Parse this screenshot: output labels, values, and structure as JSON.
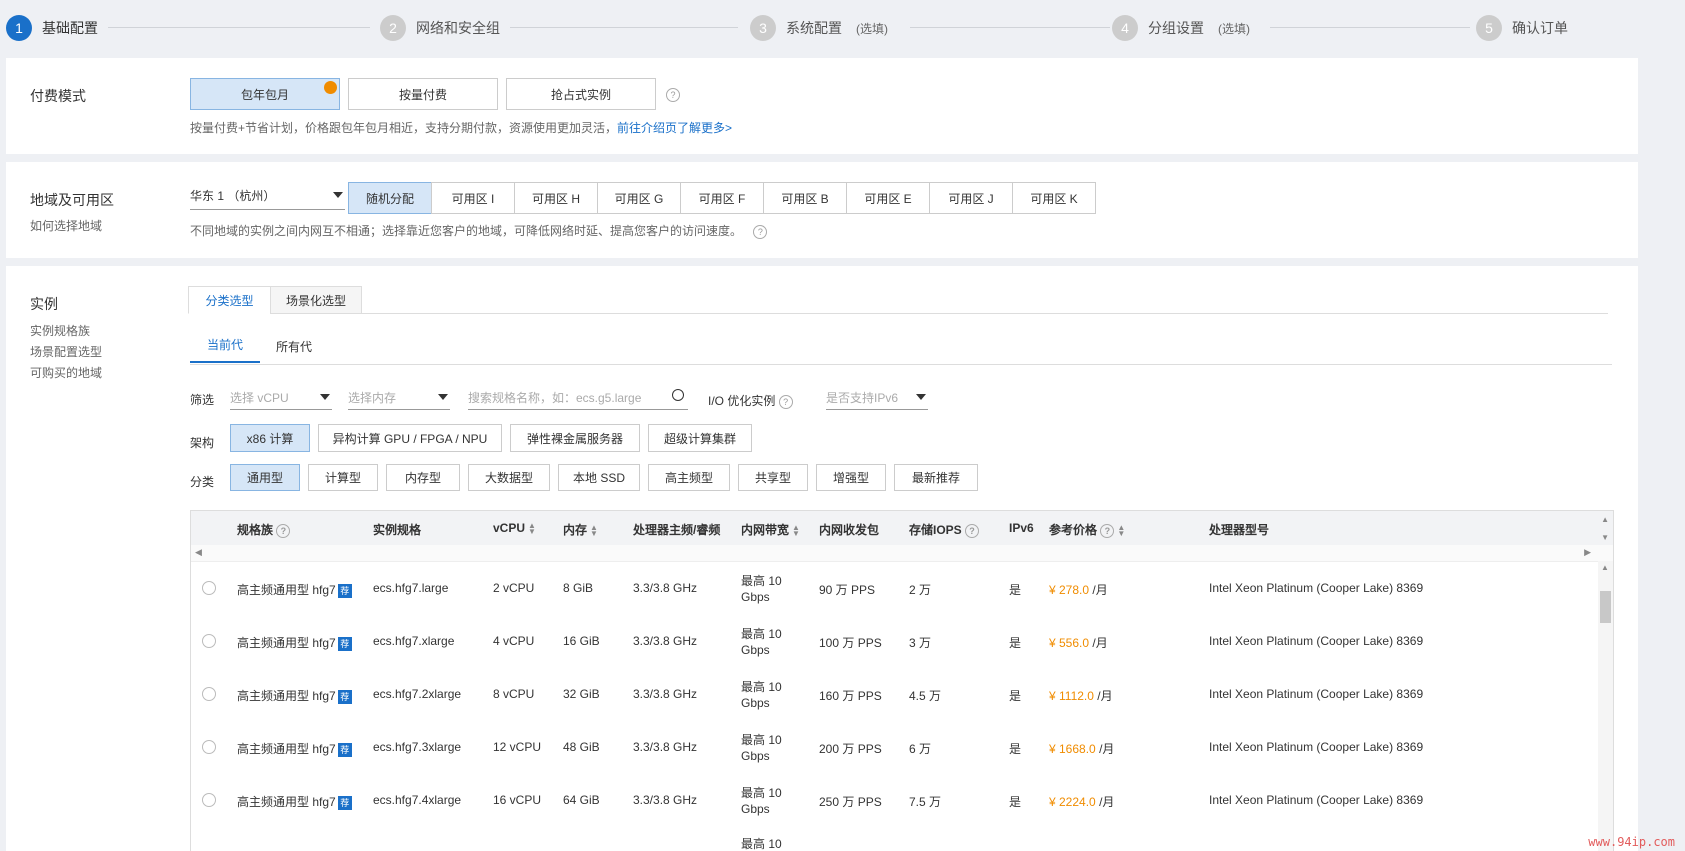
{
  "steps": [
    {
      "num": "1",
      "label": "基础配置",
      "optional": ""
    },
    {
      "num": "2",
      "label": "网络和安全组",
      "optional": ""
    },
    {
      "num": "3",
      "label": "系统配置",
      "optional": "(选填)"
    },
    {
      "num": "4",
      "label": "分组设置",
      "optional": "(选填)"
    },
    {
      "num": "5",
      "label": "确认订单",
      "optional": ""
    }
  ],
  "billing": {
    "title": "付费模式",
    "options": [
      "包年包月",
      "按量付费",
      "抢占式实例"
    ],
    "selected": "包年包月",
    "hint": "按量付费+节省计划，价格跟包年包月相近，支持分期付款，资源使用更加灵活，",
    "hint_link": "前往介绍页了解更多>"
  },
  "region": {
    "title": "地域及可用区",
    "subtitle": "如何选择地域",
    "selected_region": "华东 1 （杭州）",
    "zones": [
      "随机分配",
      "可用区 I",
      "可用区 H",
      "可用区 G",
      "可用区 F",
      "可用区 B",
      "可用区 E",
      "可用区 J",
      "可用区 K"
    ],
    "selected_zone": "随机分配",
    "hint": "不同地域的实例之间内网互不相通；选择靠近您客户的地域，可降低网络时延、提高您客户的访问速度。"
  },
  "instance": {
    "title": "实例",
    "side_links": [
      "实例规格族",
      "场景配置选型",
      "可购买的地域"
    ],
    "tabs": [
      "分类选型",
      "场景化选型"
    ],
    "subtabs": [
      "当前代",
      "所有代"
    ],
    "filter": {
      "label": "筛选",
      "vcpu_placeholder": "选择 vCPU",
      "mem_placeholder": "选择内存",
      "search_placeholder": "搜索规格名称，如：ecs.g5.large",
      "io_label": "I/O 优化实例",
      "ipv6_placeholder": "是否支持IPv6"
    },
    "arch": {
      "label": "架构",
      "options": [
        "x86 计算",
        "异构计算 GPU / FPGA / NPU",
        "弹性裸金属服务器",
        "超级计算集群"
      ],
      "selected": "x86 计算"
    },
    "category": {
      "label": "分类",
      "options": [
        "通用型",
        "计算型",
        "内存型",
        "大数据型",
        "本地 SSD",
        "高主频型",
        "共享型",
        "增强型",
        "最新推荐"
      ],
      "selected": "通用型"
    },
    "table": {
      "headers": [
        "规格族",
        "实例规格",
        "vCPU",
        "内存",
        "处理器主频/睿频",
        "内网带宽",
        "内网收发包",
        "存储IOPS",
        "IPv6",
        "参考价格",
        "处理器型号"
      ],
      "rec_badge": "荐",
      "rows": [
        {
          "family": "高主频通用型 hfg7",
          "spec": "ecs.hfg7.large",
          "vcpu": "2 vCPU",
          "mem": "8 GiB",
          "freq": "3.3/3.8 GHz",
          "bw1": "最高 10",
          "bw2": "Gbps",
          "pps": "90 万 PPS",
          "iops": "2 万",
          "ipv6": "是",
          "price": "¥ 278.0",
          "unit": "/月",
          "cpu": "Intel Xeon Platinum (Cooper Lake) 8369"
        },
        {
          "family": "高主频通用型 hfg7",
          "spec": "ecs.hfg7.xlarge",
          "vcpu": "4 vCPU",
          "mem": "16 GiB",
          "freq": "3.3/3.8 GHz",
          "bw1": "最高 10",
          "bw2": "Gbps",
          "pps": "100 万 PPS",
          "iops": "3 万",
          "ipv6": "是",
          "price": "¥ 556.0",
          "unit": "/月",
          "cpu": "Intel Xeon Platinum (Cooper Lake) 8369"
        },
        {
          "family": "高主频通用型 hfg7",
          "spec": "ecs.hfg7.2xlarge",
          "vcpu": "8 vCPU",
          "mem": "32 GiB",
          "freq": "3.3/3.8 GHz",
          "bw1": "最高 10",
          "bw2": "Gbps",
          "pps": "160 万 PPS",
          "iops": "4.5 万",
          "ipv6": "是",
          "price": "¥ 1112.0",
          "unit": "/月",
          "cpu": "Intel Xeon Platinum (Cooper Lake) 8369"
        },
        {
          "family": "高主频通用型 hfg7",
          "spec": "ecs.hfg7.3xlarge",
          "vcpu": "12 vCPU",
          "mem": "48 GiB",
          "freq": "3.3/3.8 GHz",
          "bw1": "最高 10",
          "bw2": "Gbps",
          "pps": "200 万 PPS",
          "iops": "6 万",
          "ipv6": "是",
          "price": "¥ 1668.0",
          "unit": "/月",
          "cpu": "Intel Xeon Platinum (Cooper Lake) 8369"
        },
        {
          "family": "高主频通用型 hfg7",
          "spec": "ecs.hfg7.4xlarge",
          "vcpu": "16 vCPU",
          "mem": "64 GiB",
          "freq": "3.3/3.8 GHz",
          "bw1": "最高 10",
          "bw2": "Gbps",
          "pps": "250 万 PPS",
          "iops": "7.5 万",
          "ipv6": "是",
          "price": "¥ 2224.0",
          "unit": "/月",
          "cpu": "Intel Xeon Platinum (Cooper Lake) 8369"
        },
        {
          "family": "",
          "spec": "",
          "vcpu": "",
          "mem": "",
          "freq": "",
          "bw1": "最高 10",
          "bw2": "",
          "pps": "",
          "iops": "",
          "ipv6": "",
          "price": "",
          "unit": "",
          "cpu": ""
        }
      ]
    }
  },
  "watermark": "www.94ip.com"
}
